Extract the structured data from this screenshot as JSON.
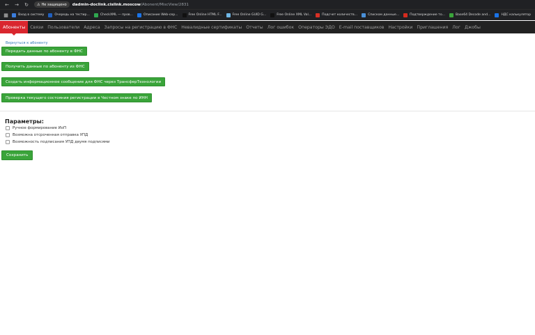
{
  "browser": {
    "security_label": "Не защищено",
    "url_host": "dadmin-doclink.cislink.moscow",
    "url_path": "/Abonent/MiscView/2831"
  },
  "bookmarks": [
    {
      "label": "Вход в систему",
      "color": "#3b7ddd"
    },
    {
      "label": "Очередь на тестир...",
      "color": "#1f5fbf"
    },
    {
      "label": "CheckXML — пров...",
      "color": "#2fa84f"
    },
    {
      "label": "Описание Web-сер...",
      "color": "#1a73e8"
    },
    {
      "label": "Free Online HTML F...",
      "color": "#111111"
    },
    {
      "label": "Free Online GUID G...",
      "color": "#6fb7e6"
    },
    {
      "label": "Free Online XML Val...",
      "color": "#111111"
    },
    {
      "label": "Подсчет количеств...",
      "color": "#d93025"
    },
    {
      "label": "Списком данные...",
      "color": "#4a90d9"
    },
    {
      "label": "Подтверждение то...",
      "color": "#d52b1e"
    },
    {
      "label": "Base64 Decode and...",
      "color": "#3aa43a"
    },
    {
      "label": "НДС калькулятор",
      "color": "#1a73e8"
    }
  ],
  "nav": {
    "items": [
      "Абоненты",
      "Связи",
      "Пользователи",
      "Адреса",
      "Запросы на регистрацию в ФНС",
      "Невалидные сертификаты",
      "Отчеты",
      "Лог ошибок",
      "Операторы ЭДО",
      "E-mail поставщиков",
      "Настройки",
      "Приглашения",
      "Лог",
      "Джобы"
    ],
    "active_index": 0
  },
  "content": {
    "back_link": "Вернуться к абоненту",
    "buttons": [
      "Передать данные по абоненту в ФНС",
      "Получить данные по абоненту из ФНС",
      "Создать информационное сообщение для ФНС через ТрансферТехнологии",
      "Проверка текущего состояния регистрации в Честном знаке по ИНН"
    ],
    "params_title": "Параметры:",
    "checkboxes": [
      {
        "label": "Ручное формирование ИоП",
        "checked": false
      },
      {
        "label": "Возможна отсроченная отправка УПД",
        "checked": false
      },
      {
        "label": "Возможность подписания УПД двумя подписями",
        "checked": false
      }
    ],
    "save_label": "Сохранить"
  },
  "colors": {
    "active_nav": "#d9262e",
    "button_green": "#3aa43a",
    "nav_background": "#222222"
  }
}
